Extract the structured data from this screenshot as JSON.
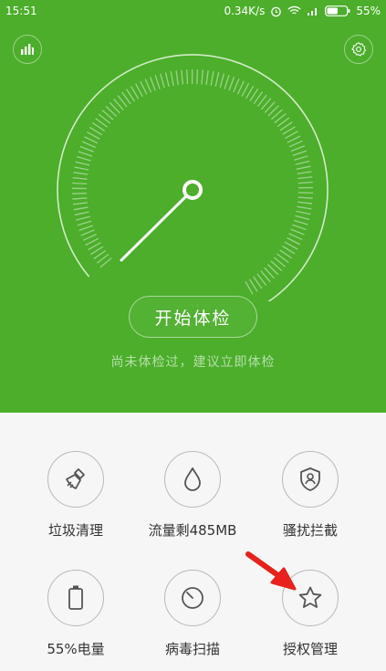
{
  "status_bar": {
    "time": "15:51",
    "speed": "0.34K/s",
    "battery": "55%"
  },
  "header": {
    "start_button_label": "开始体检",
    "hint": "尚未体检过，建议立即体检"
  },
  "tools": [
    {
      "label": "垃圾清理",
      "icon": "broom-icon"
    },
    {
      "label": "流量剩485MB",
      "icon": "droplet-icon"
    },
    {
      "label": "骚扰拦截",
      "icon": "shield-user-icon"
    },
    {
      "label": "55%电量",
      "icon": "battery-icon"
    },
    {
      "label": "病毒扫描",
      "icon": "scan-dial-icon"
    },
    {
      "label": "授权管理",
      "icon": "star-icon"
    }
  ],
  "colors": {
    "header_green": "#4cae2b",
    "annotation_red": "#e8211c",
    "icon_gray": "#555555"
  }
}
